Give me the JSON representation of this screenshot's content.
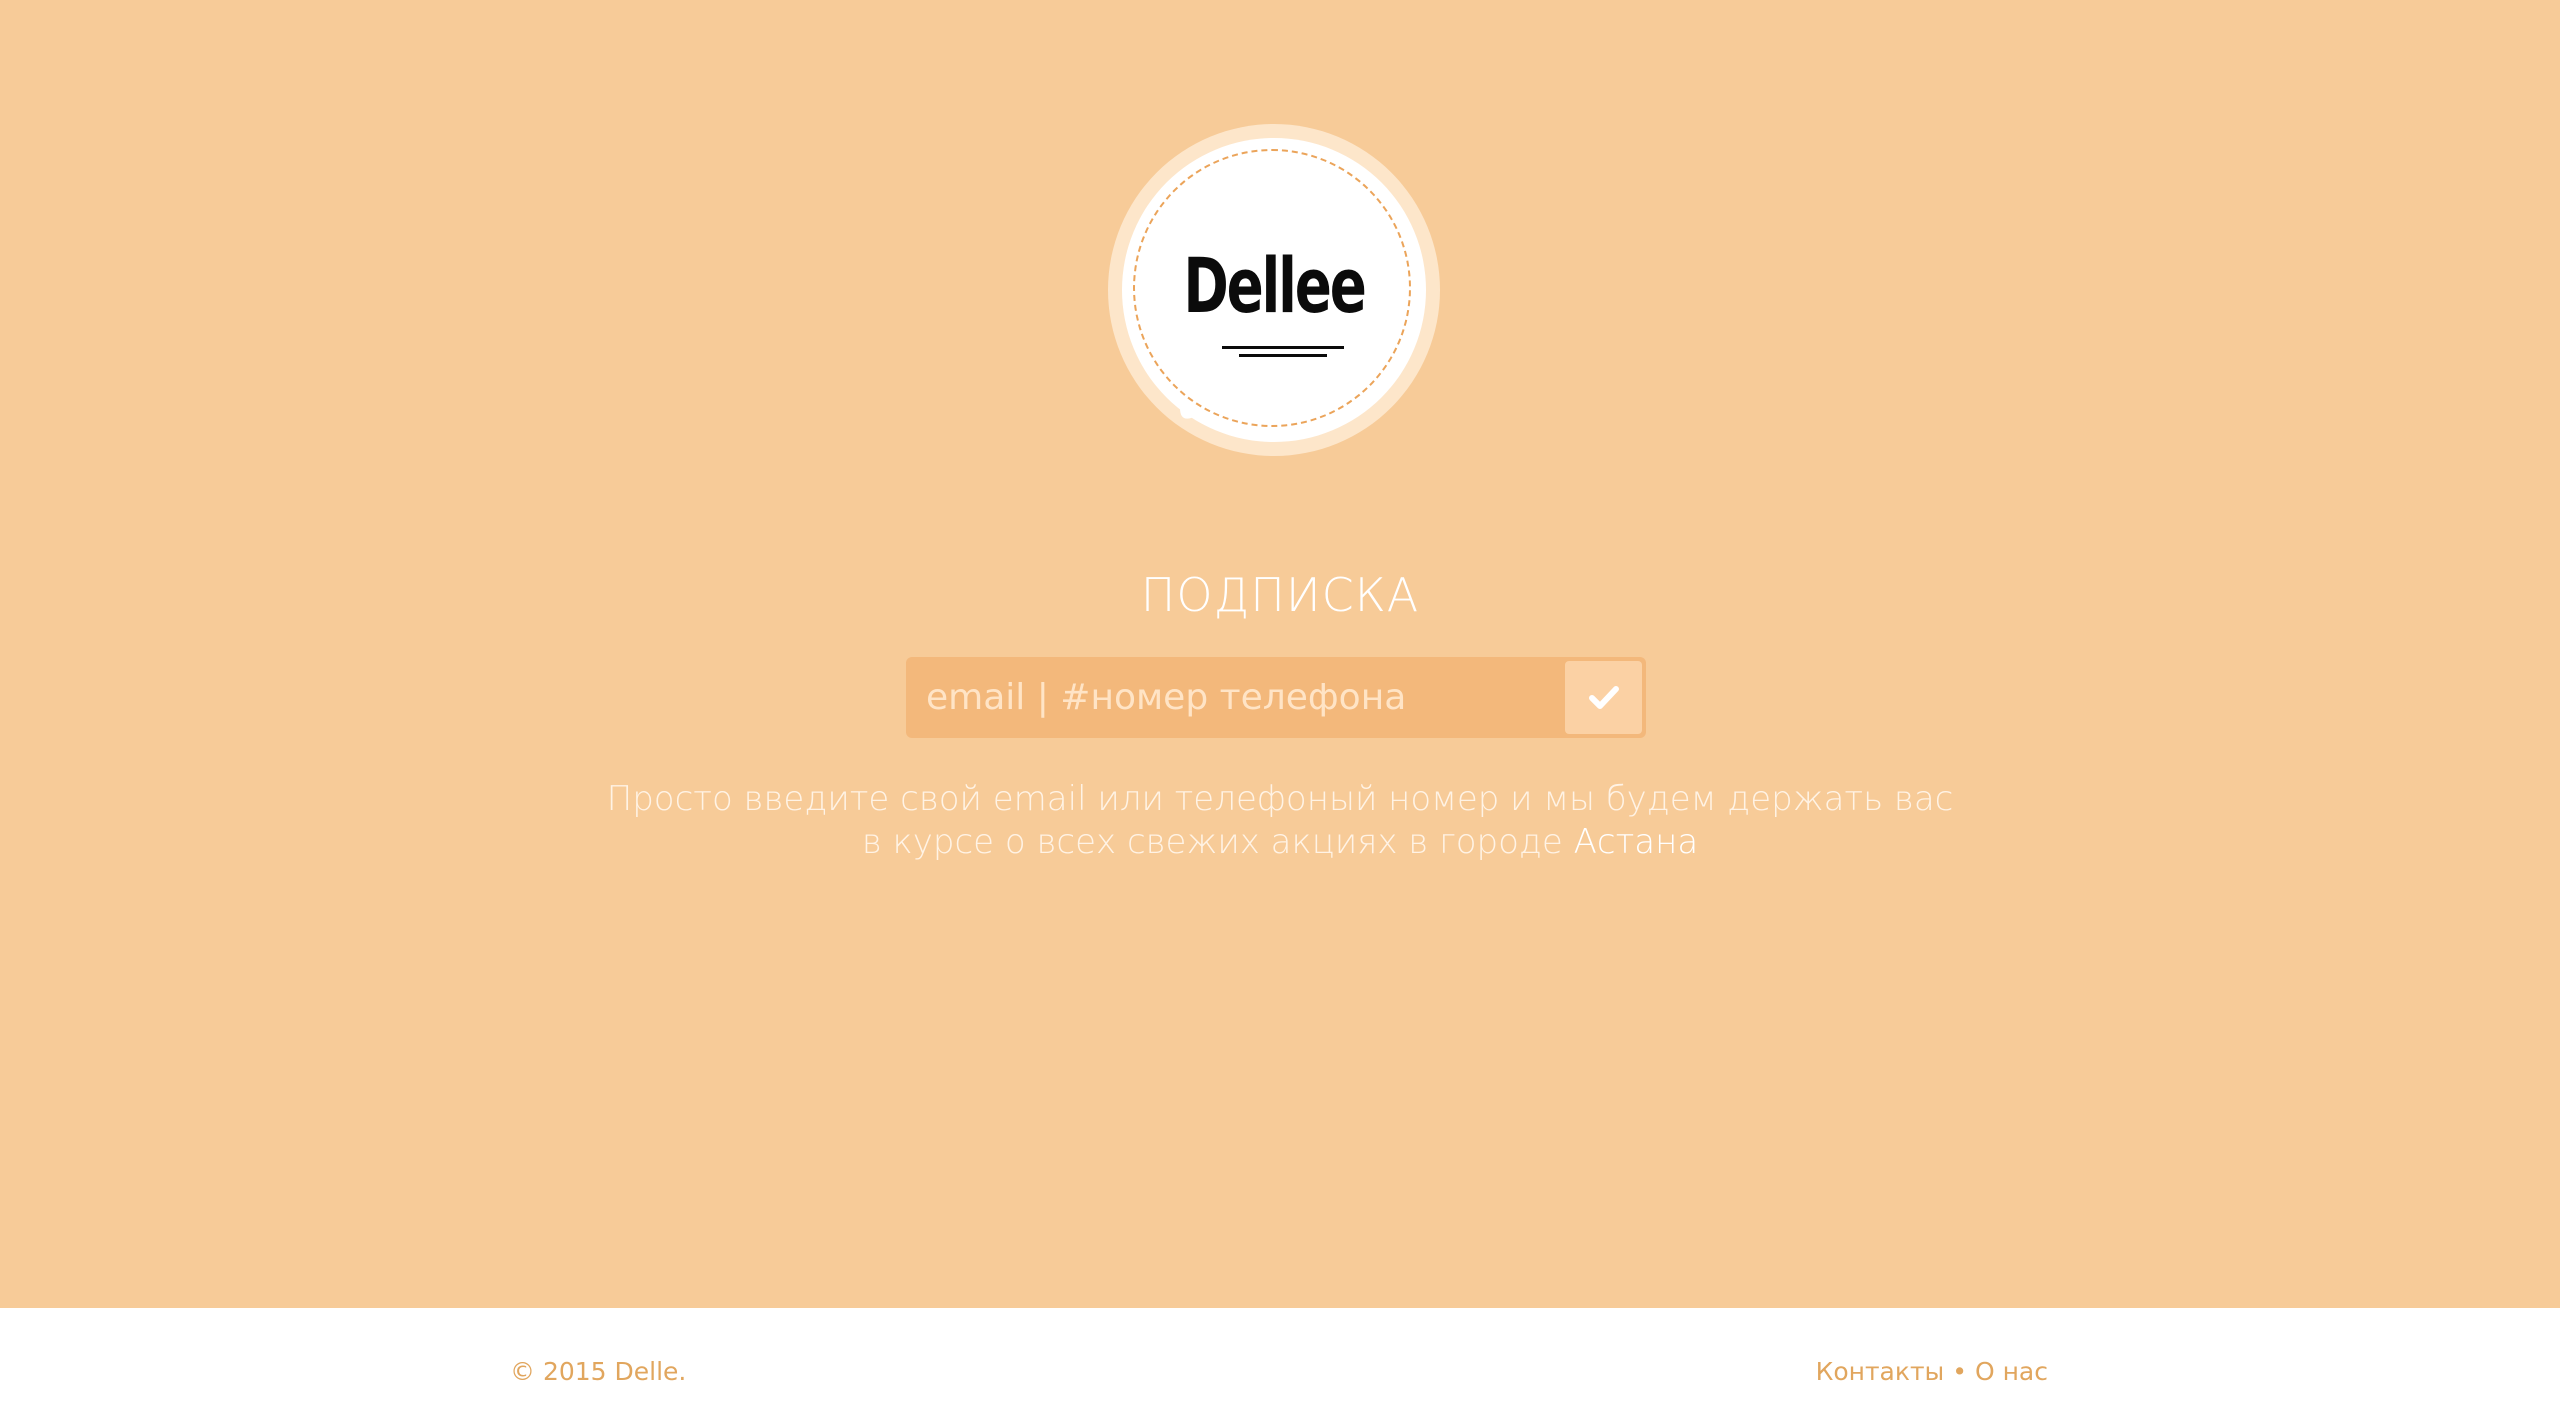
{
  "brand": {
    "logo_text": "Dellee",
    "colors": {
      "background": "#f7cb98",
      "input_background": "#f3b87b",
      "button_background": "#fbd1a4",
      "accent_text": "#e1a65e",
      "logo_dash": "#eba45a"
    }
  },
  "subscribe": {
    "title": "ПОДПИСКА",
    "input_placeholder": "email | #номер телефона",
    "input_value": "",
    "submit_icon": "check-icon"
  },
  "description": {
    "line1": "Просто введите свой email или телефоный номер и мы будем держать вас",
    "line2_prefix": "в курсе о всех свежих акциях в городе ",
    "city": "Астана"
  },
  "footer": {
    "copyright": "© 2015 Delle.",
    "links": [
      {
        "label": "Контакты"
      },
      {
        "label": "О нас"
      }
    ],
    "separator": "•"
  }
}
